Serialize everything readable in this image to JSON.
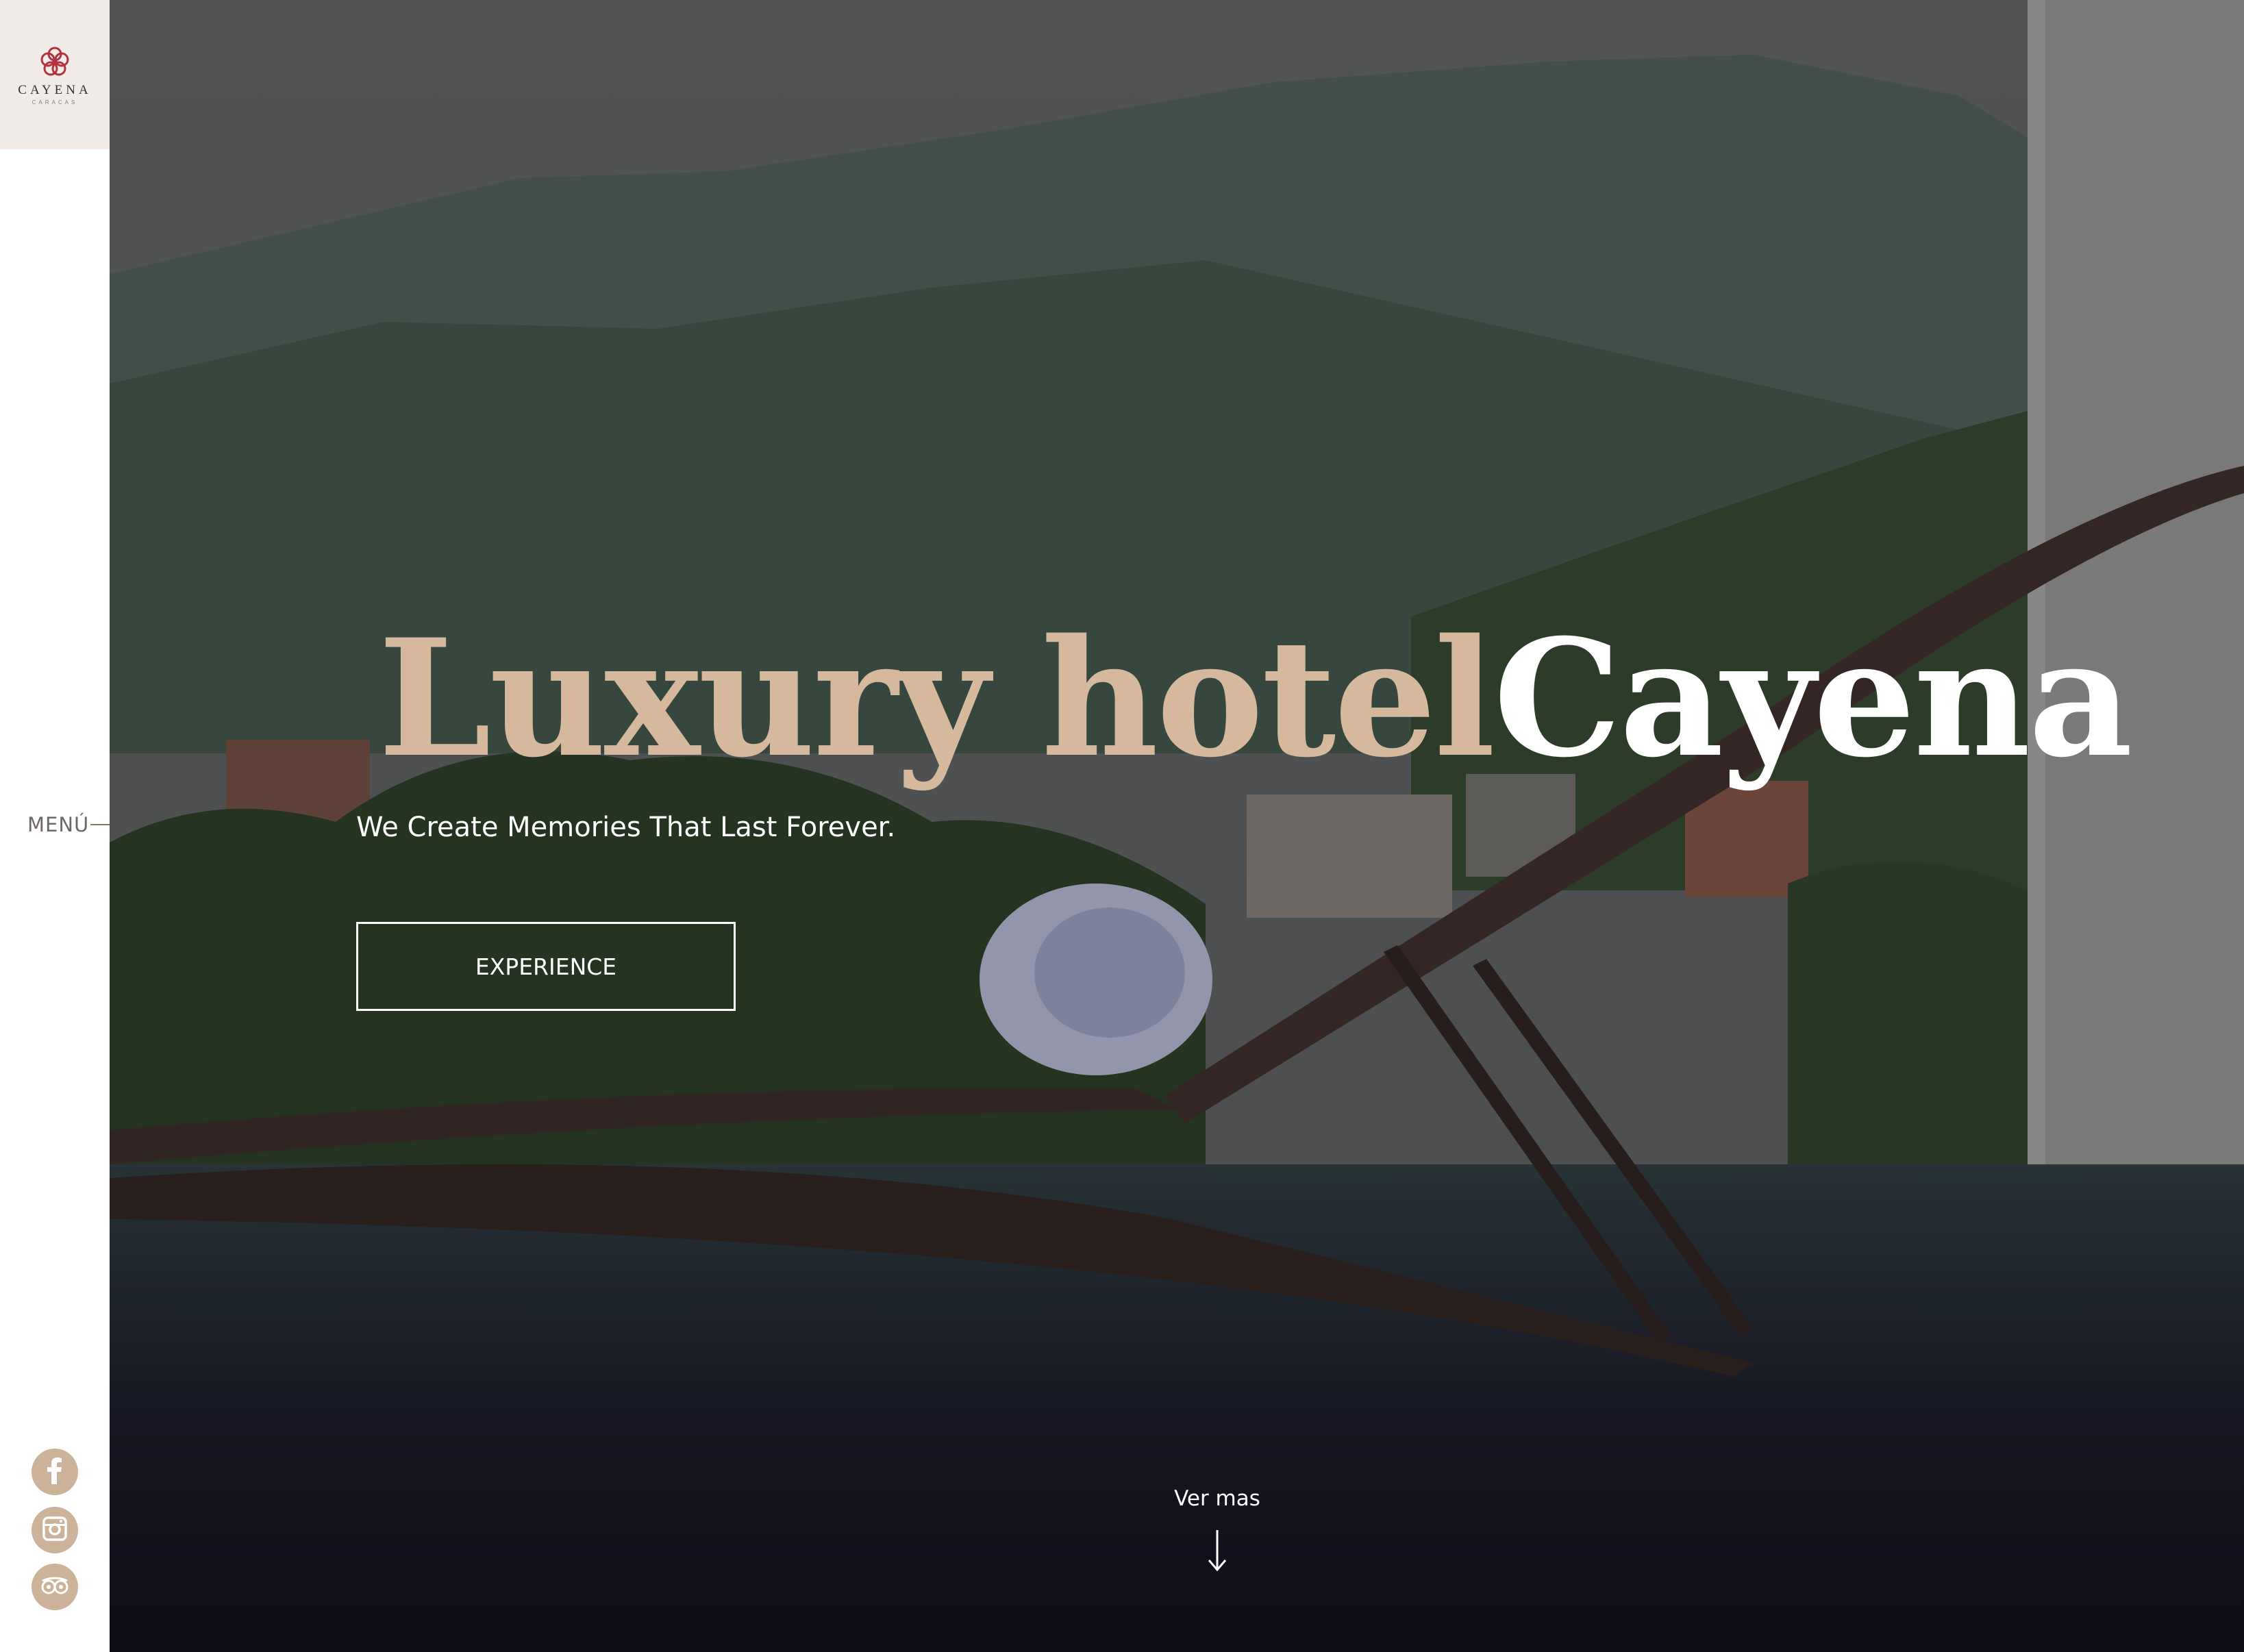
{
  "brand": {
    "name": "CAYENA",
    "subtitle": "CARACAS",
    "accent_color": "#d6b99d",
    "logo_color": "#b3323f"
  },
  "sidebar": {
    "menu_label": "MENÚ",
    "social": [
      {
        "name": "facebook",
        "icon": "facebook-icon"
      },
      {
        "name": "instagram",
        "icon": "instagram-icon"
      },
      {
        "name": "tripadvisor",
        "icon": "tripadvisor-icon"
      }
    ]
  },
  "hero": {
    "title_part1": "Luxury hotel",
    "title_part2": "Cayena",
    "subtitle": "We Create Memories That Last Forever.",
    "cta_label": "EXPERIENCE",
    "scroll_label": "Ver mas",
    "scroll_icon": "arrow-down-icon"
  }
}
